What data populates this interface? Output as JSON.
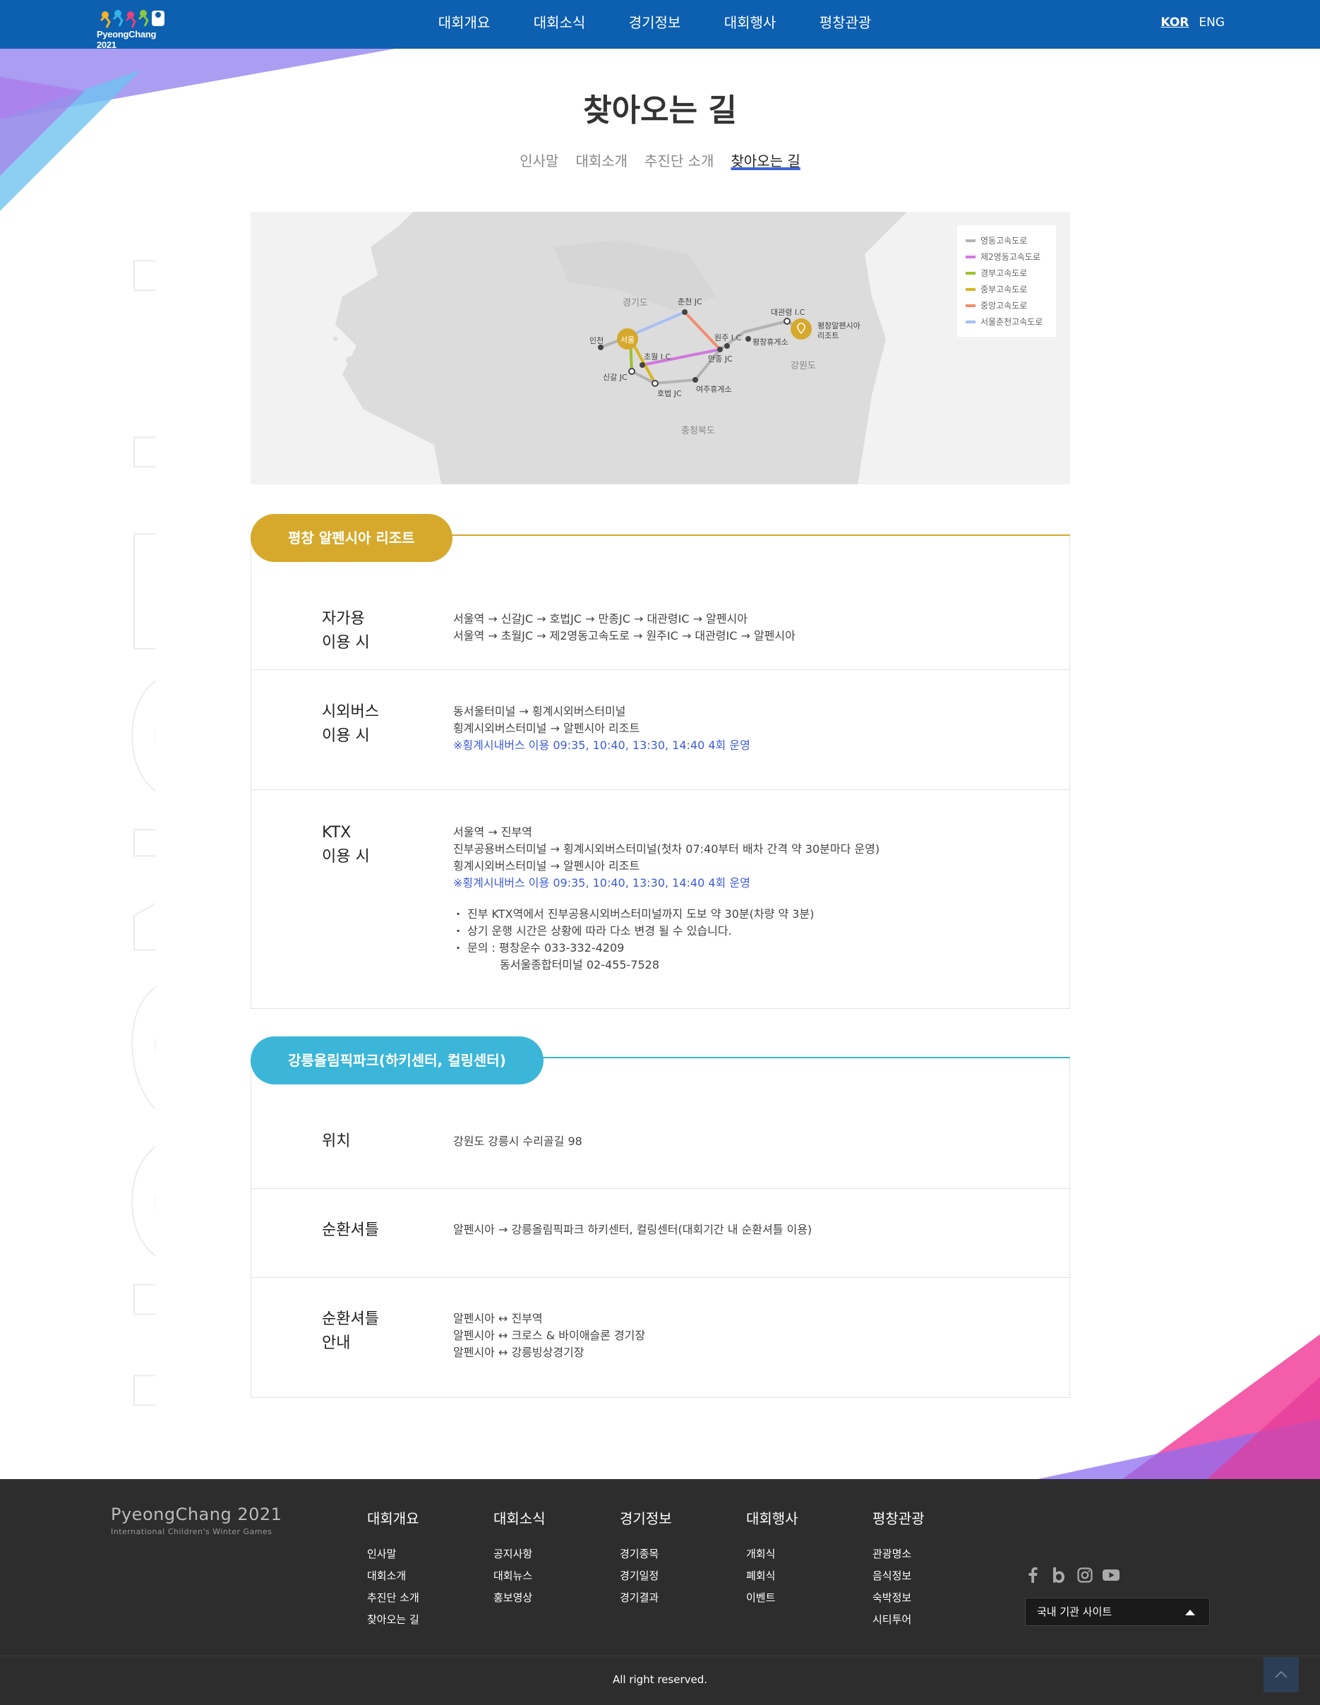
{
  "header": {
    "logo_text": "PyeongChang 2021",
    "nav": [
      "대회개요",
      "대회소식",
      "경기정보",
      "대회행사",
      "평창관광"
    ],
    "lang": {
      "kor": "KOR",
      "eng": "ENG"
    }
  },
  "watermark_text": "PYEONGCH",
  "page": {
    "title": "찾아오는 길",
    "subnav": [
      "인사말",
      "대회소개",
      "추진단 소개",
      "찾아오는 길"
    ]
  },
  "map": {
    "legend": [
      {
        "label": "영동고속도로",
        "color": "#b3b3b3"
      },
      {
        "label": "제2영동고속도로",
        "color": "#d277e0"
      },
      {
        "label": "경부고속도로",
        "color": "#9ac12e"
      },
      {
        "label": "중부고속도로",
        "color": "#d8b420"
      },
      {
        "label": "중앙고속도로",
        "color": "#f08f6e"
      },
      {
        "label": "서울춘천고속도로",
        "color": "#a7c0f2"
      }
    ],
    "regions": {
      "gyeonggi": "경기도",
      "gangwon": "강원도",
      "chungbuk": "충청북도"
    },
    "places": {
      "seoul": "서울",
      "incheon": "인천",
      "chuncheon": "춘천 JC",
      "daegwallyeong": "대관령 I.C",
      "resort": "평창알펜시아\n리조트",
      "wonju_ic": "원주 I.C",
      "pyeongchang_rest": "평창휴게소",
      "manjong": "만종 JC",
      "chowol": "초월 I.C",
      "singal": "신갈 JC",
      "hobeop": "호법 JC",
      "yeoju": "여주휴게소"
    }
  },
  "sections": [
    {
      "title": "평창 알펜시아 리조트",
      "color": "#d6a92c",
      "rows": [
        {
          "label": "자가용\n이용 시",
          "lines": [
            "서울역 → 신갈JC → 호법JC → 만종JC → 대관령IC → 알펜시아",
            "서울역 → 초월JC → 제2영동고속도로 → 원주IC → 대관령IC → 알펜시아"
          ]
        },
        {
          "label": "시외버스\n이용 시",
          "lines": [
            "동서울터미널 → 횡계시외버스터미널",
            "횡계시외버스터미널 → 알펜시아 리조트"
          ],
          "note": "※횡계시내버스 이용 09:35, 10:40, 13:30, 14:40 4회 운영"
        },
        {
          "label": "KTX\n이용 시",
          "lines": [
            "서울역 → 진부역",
            "진부공용버스터미널 → 횡계시외버스터미널(첫차 07:40부터 배차 간격 약 30분마다 운영)",
            "횡계시외버스터미널 → 알펜시아 리조트"
          ],
          "note": "※횡계시내버스 이용 09:35, 10:40, 13:30, 14:40 4회 운영",
          "bullets": [
            "진부 KTX역에서 진부공용시외버스터미널까지 도보 약 30분(차량 약 3분)",
            "상기 운행 시간은 상황에 따라 다소 변경 될 수 있습니다.",
            "문의 : 평창운수 033-332-4209"
          ],
          "indent": "동서울종합터미널 02-455-7528"
        }
      ]
    },
    {
      "title": "강릉올림픽파크(하키센터, 컬링센터)",
      "color": "#3bb6d9",
      "rows": [
        {
          "label": "위치",
          "lines": [
            "강원도 강릉시 수리골길 98"
          ]
        },
        {
          "label": "순환셔틀",
          "lines": [
            "알펜시아 → 강릉올림픽파크 하키센터, 컬링센터(대회기간 내 순환셔틀 이용)"
          ]
        },
        {
          "label": "순환셔틀\n안내",
          "lines": [
            "알펜시아 ↔ 진부역",
            "알펜시아 ↔ 크로스 & 바이애슬론 경기장",
            "알펜시아 ↔ 강릉빙상경기장"
          ]
        }
      ]
    }
  ],
  "footer": {
    "brand": "PyeongChang 2021",
    "brand_sub": "International Children's Winter Games",
    "columns": [
      {
        "title": "대회개요",
        "links": [
          "인사말",
          "대회소개",
          "추진단 소개",
          "찾아오는 길"
        ]
      },
      {
        "title": "대회소식",
        "links": [
          "공지사항",
          "대회뉴스",
          "홍보영상"
        ]
      },
      {
        "title": "경기정보",
        "links": [
          "경기종목",
          "경기일정",
          "경기결과"
        ]
      },
      {
        "title": "대회행사",
        "links": [
          "개회식",
          "폐회식",
          "이벤트"
        ]
      },
      {
        "title": "평창관광",
        "links": [
          "관광명소",
          "음식정보",
          "숙박정보",
          "시티투어"
        ]
      }
    ],
    "sns": [
      "facebook-icon",
      "blog-icon",
      "instagram-icon",
      "youtube-icon"
    ],
    "site_select": "국내 기관 사이트",
    "copyright": "All right reserved."
  }
}
